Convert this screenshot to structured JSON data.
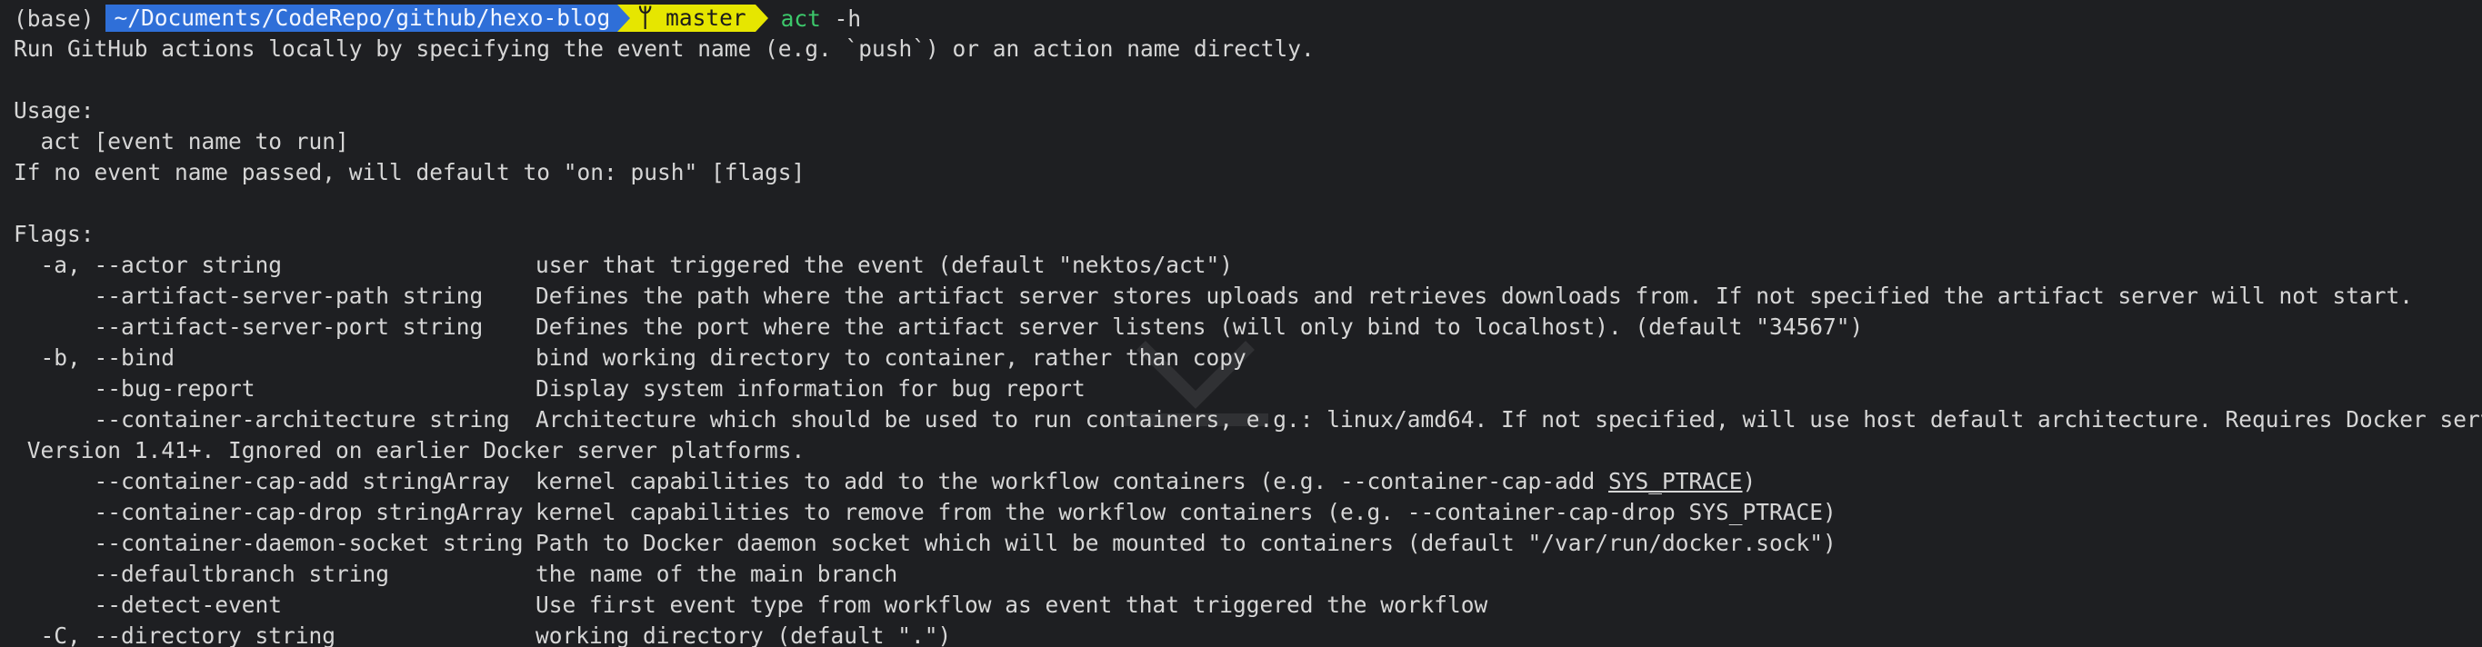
{
  "prompt": {
    "env": "(base)",
    "path": "~/Documents/CodeRepo/github/hexo-blog",
    "branch_icon": "git-branch-icon",
    "branch": "master",
    "command": "act",
    "command_args": "-h"
  },
  "intro": "Run GitHub actions locally by specifying the event name (e.g. `push`) or an action name directly.",
  "usage_header": "Usage:",
  "usage_line": "  act [event name to run]",
  "default_note": "If no event name passed, will default to \"on: push\" [flags]",
  "flags_header": "Flags:",
  "flags": [
    {
      "flag": "  -a, --actor string",
      "desc": "user that triggered the event (default \"nektos/act\")"
    },
    {
      "flag": "      --artifact-server-path string",
      "desc": "Defines the path where the artifact server stores uploads and retrieves downloads from. If not specified the artifact server will not start."
    },
    {
      "flag": "      --artifact-server-port string",
      "desc": "Defines the port where the artifact server listens (will only bind to localhost). (default \"34567\")"
    },
    {
      "flag": "  -b, --bind",
      "desc": "bind working directory to container, rather than copy"
    },
    {
      "flag": "      --bug-report",
      "desc": "Display system information for bug report"
    },
    {
      "flag": "      --container-architecture string",
      "desc": "Architecture which should be used to run containers, e.g.: linux/amd64. If not specified, will use host default architecture. Requires Docker server API"
    },
    {
      "flag": " Version 1.41+. Ignored on earlier Docker server platforms.",
      "desc": ""
    },
    {
      "flag": "      --container-cap-add stringArray",
      "desc_pre": "kernel capabilities to add to the workflow containers (e.g. --container-cap-add ",
      "desc_underlined": "SYS_PTRACE",
      "desc_post": ")"
    },
    {
      "flag": "      --container-cap-drop stringArray",
      "desc": "kernel capabilities to remove from the workflow containers (e.g. --container-cap-drop SYS_PTRACE)"
    },
    {
      "flag": "      --container-daemon-socket string",
      "desc": "Path to Docker daemon socket which will be mounted to containers (default \"/var/run/docker.sock\")"
    },
    {
      "flag": "      --defaultbranch string",
      "desc": "the name of the main branch"
    },
    {
      "flag": "      --detect-event",
      "desc": "Use first event type from workflow as event that triggered the workflow"
    },
    {
      "flag": "  -C, --directory string",
      "desc": "working directory (default \".\")"
    }
  ]
}
